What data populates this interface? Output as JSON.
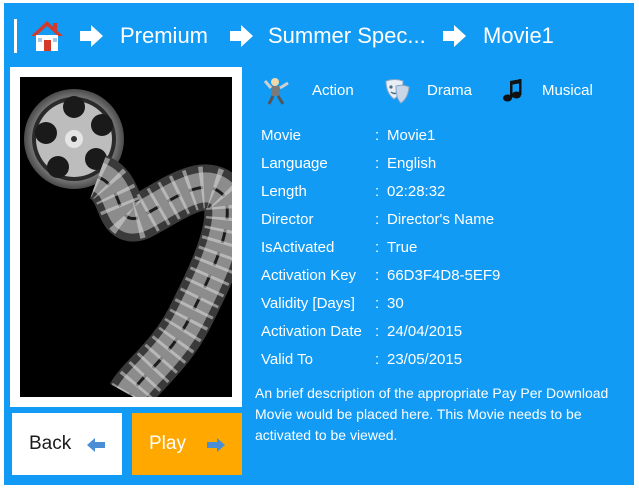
{
  "breadcrumb": {
    "items": [
      {
        "label": "Premium"
      },
      {
        "label": "Summer Spec..."
      },
      {
        "label": "Movie1"
      }
    ]
  },
  "genres": [
    {
      "label": "Action",
      "icon": "action-figure-icon"
    },
    {
      "label": "Drama",
      "icon": "drama-masks-icon"
    },
    {
      "label": "Musical",
      "icon": "music-note-icon"
    }
  ],
  "details": [
    {
      "label": "Movie",
      "value": "Movie1"
    },
    {
      "label": "Language",
      "value": "English"
    },
    {
      "label": "Length",
      "value": "02:28:32"
    },
    {
      "label": "Director",
      "value": "Director's Name"
    },
    {
      "label": "IsActivated",
      "value": "True"
    },
    {
      "label": "Activation Key",
      "value": "66D3F4D8-5EF9"
    },
    {
      "label": "Validity [Days]",
      "value": "30"
    },
    {
      "label": "Activation Date",
      "value": "24/04/2015"
    },
    {
      "label": "Valid To",
      "value": "23/05/2015"
    }
  ],
  "separator": ":",
  "description": "An brief description of the appropriate Pay Per Download Movie would be placed here. This Movie needs to be activated to be viewed.",
  "buttons": {
    "back_label": "Back",
    "play_label": "Play"
  },
  "colors": {
    "background": "#129bf4",
    "play_button": "#ffa800",
    "back_button": "#ffffff",
    "arrow_accent": "#4a8fd6"
  }
}
